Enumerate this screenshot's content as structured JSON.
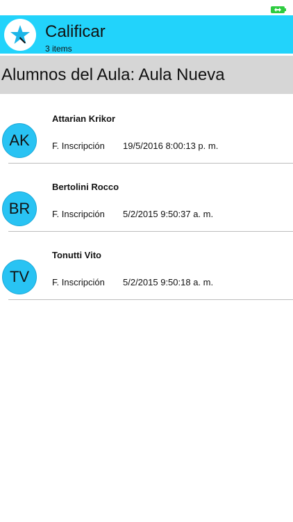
{
  "status_bar": {
    "battery_icon": "battery-charging-icon",
    "battery_color": "#2ecc40"
  },
  "header": {
    "title": "Calificar",
    "subtitle": "3 items",
    "logo_icon": "star-icon",
    "background_color": "#22d3fb"
  },
  "section": {
    "title": "Alumnos del Aula: Aula Nueva"
  },
  "students": [
    {
      "initials": "AK",
      "name": "Attarian Krikor",
      "label": "F. Inscripción",
      "date": "19/5/2016 8:00:13 p. m."
    },
    {
      "initials": "BR",
      "name": "Bertolini Rocco",
      "label": "F. Inscripción",
      "date": "5/2/2015 9:50:37 a. m."
    },
    {
      "initials": "TV",
      "name": "Tonutti Vito",
      "label": "F. Inscripción",
      "date": "5/2/2015 9:50:18 a. m."
    }
  ],
  "colors": {
    "avatar": "#29c3f3",
    "section_bg": "#d6d6d6"
  }
}
